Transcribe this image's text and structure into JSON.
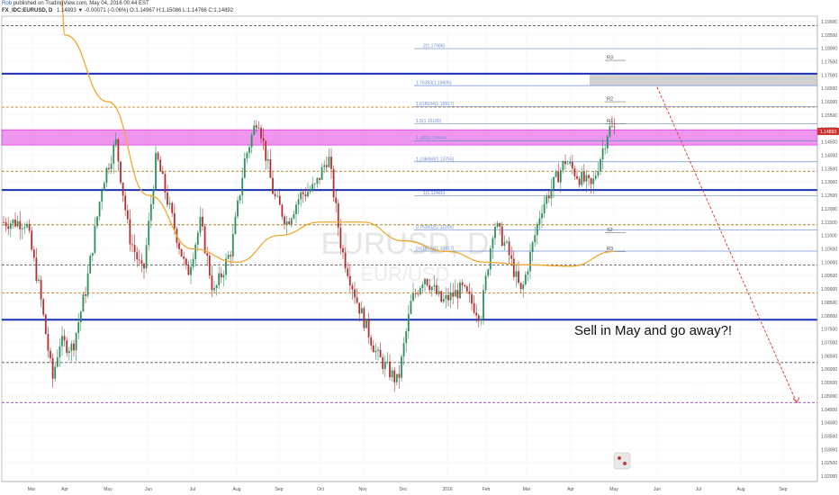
{
  "header": {
    "publisher": "Rob",
    "publish_text": "published on TradingView.com, May 04, 2016 00:44 EST",
    "symbol": "FX_IDC:EURUSD, D",
    "quote": "1.14893 ▼ -0.00071 (-0.06%) O:1.14967 H:1.15086 L:1.14768 C:1.14892"
  },
  "watermark": {
    "line1": "EURUSD, D",
    "line2": "EUR/USD"
  },
  "annotation": "Sell in May and go away?!",
  "current_price_label": "1.14893",
  "colors": {
    "bull": "#2f8f5e",
    "bear": "#b03030",
    "ma": "#f0a830",
    "blue_level": "#1a2fb5",
    "magenta_zone": "#e040e0",
    "fib": "#6a8fd0",
    "forecast": "#e04040"
  },
  "chart_data": {
    "type": "candlestick",
    "x_tick_labels": [
      "Mar",
      "Apr",
      "May",
      "Jun",
      "Jul",
      "Aug",
      "Sep",
      "Oct",
      "Nov",
      "Dec",
      "2016",
      "Feb",
      "Mar",
      "Apr",
      "May",
      "Jun",
      "Jul",
      "Aug",
      "Sep"
    ],
    "y_tick_labels": [
      "1.19000",
      "1.18500",
      "1.18000",
      "1.17500",
      "1.17000",
      "1.16500",
      "1.16000",
      "1.15500",
      "1.15000",
      "1.14500",
      "1.14000",
      "1.13500",
      "1.13000",
      "1.12500",
      "1.12000",
      "1.11500",
      "1.11000",
      "1.10500",
      "1.10000",
      "1.09500",
      "1.09000",
      "1.08500",
      "1.08000",
      "1.07500",
      "1.07000",
      "1.06500",
      "1.06000",
      "1.05500",
      "1.05000",
      "1.04500",
      "1.04000",
      "1.03500",
      "1.03000",
      "1.02500",
      "1.02000"
    ],
    "ylim": [
      1.018,
      1.192
    ],
    "ohlc_path": [
      [
        "Mar",
        1.115
      ],
      [
        "Mar",
        1.09
      ],
      [
        "Mar",
        1.056
      ],
      [
        "Apr",
        1.07
      ],
      [
        "Apr",
        1.068
      ],
      [
        "Apr",
        1.09
      ],
      [
        "May",
        1.13
      ],
      [
        "May",
        1.145
      ],
      [
        "May",
        1.11
      ],
      [
        "Jun",
        1.095
      ],
      [
        "Jun",
        1.14
      ],
      [
        "Jun",
        1.12
      ],
      [
        "Jul",
        1.095
      ],
      [
        "Jul",
        1.115
      ],
      [
        "Jul",
        1.088
      ],
      [
        "Aug",
        1.105
      ],
      [
        "Aug",
        1.138
      ],
      [
        "Aug",
        1.155
      ],
      [
        "Sep",
        1.125
      ],
      [
        "Sep",
        1.115
      ],
      [
        "Sep",
        1.125
      ],
      [
        "Oct",
        1.128
      ],
      [
        "Oct",
        1.14
      ],
      [
        "Oct",
        1.105
      ],
      [
        "Nov",
        1.085
      ],
      [
        "Nov",
        1.065
      ],
      [
        "Dec",
        1.055
      ],
      [
        "Dec",
        1.085
      ],
      [
        "Dec",
        1.095
      ],
      [
        "2016",
        1.085
      ],
      [
        "2016",
        1.09
      ],
      [
        "Feb",
        1.08
      ],
      [
        "Feb",
        1.115
      ],
      [
        "Feb",
        1.105
      ],
      [
        "Mar",
        1.088
      ],
      [
        "Mar",
        1.12
      ],
      [
        "Apr",
        1.138
      ],
      [
        "Apr",
        1.132
      ],
      [
        "Apr",
        1.128
      ],
      [
        "May",
        1.15
      ],
      [
        "May",
        1.1489
      ]
    ],
    "moving_average": [
      [
        "Mar",
        1.2
      ],
      [
        "Apr",
        1.185
      ],
      [
        "May",
        1.16
      ],
      [
        "Jun",
        1.125
      ],
      [
        "Jul",
        1.105
      ],
      [
        "Aug",
        1.1
      ],
      [
        "Sep",
        1.11
      ],
      [
        "Oct",
        1.115
      ],
      [
        "Nov",
        1.115
      ],
      [
        "Dec",
        1.108
      ],
      [
        "2016",
        1.104
      ],
      [
        "Feb",
        1.1
      ],
      [
        "Mar",
        1.099
      ],
      [
        "Apr",
        1.0985
      ],
      [
        "May",
        1.104
      ]
    ],
    "horizontal_levels": [
      {
        "price": 1.1885,
        "style": "dashed",
        "color": "#555555"
      },
      {
        "price": 1.1705,
        "style": "solid",
        "color": "#1a2fb5"
      },
      {
        "price": 1.127,
        "style": "solid",
        "color": "#1a2fb5"
      },
      {
        "price": 1.114,
        "style": "dashed",
        "color": "#b08020"
      },
      {
        "price": 1.099,
        "style": "dashed",
        "color": "#555555"
      },
      {
        "price": 1.0885,
        "style": "dashed",
        "color": "#e08020"
      },
      {
        "price": 1.0785,
        "style": "solid",
        "color": "#1a2fb5"
      },
      {
        "price": 1.0625,
        "style": "dashed",
        "color": "#555555"
      },
      {
        "price": 1.0475,
        "style": "dashed",
        "color": "#a040c0"
      },
      {
        "price": 1.158,
        "style": "dashed",
        "color": "#e08020"
      },
      {
        "price": 1.134,
        "style": "dashed",
        "color": "#b08020"
      }
    ],
    "fib_levels": [
      {
        "label": "2(1.17986)",
        "price": 1.17986
      },
      {
        "label": "1.76393(1.16605)",
        "price": 1.16605
      },
      {
        "label": "1.618034(1.15817)",
        "price": 1.15817
      },
      {
        "label": "1.5(1.15180)",
        "price": 1.1518
      },
      {
        "label": "1.382(1.14544)",
        "price": 1.14544
      },
      {
        "label": "1.236068(1.13755)",
        "price": 1.13755
      },
      {
        "label": "1(1.12480)",
        "price": 1.1248
      },
      {
        "label": "0.763932(1.11205)",
        "price": 1.11205
      },
      {
        "label": "0.618034(1.10417)",
        "price": 1.10417
      }
    ],
    "pivots": [
      {
        "label": "R3",
        "price": 1.1755
      },
      {
        "label": "R2",
        "price": 1.16
      },
      {
        "label": "R1",
        "price": 1.1518
      },
      {
        "label": "S2",
        "price": 1.111
      },
      {
        "label": "R3",
        "price": 1.104
      }
    ],
    "zones": [
      {
        "name": "magenta-resistance",
        "from": 1.1455,
        "to": 1.1485,
        "color": "#e040e0"
      },
      {
        "name": "grey-target",
        "from": 1.166,
        "to": 1.1705,
        "color": "#c8c8c8"
      }
    ],
    "forecast_line": {
      "from": [
        "May",
        1.1655
      ],
      "to": [
        "Sep",
        1.0475
      ]
    }
  }
}
